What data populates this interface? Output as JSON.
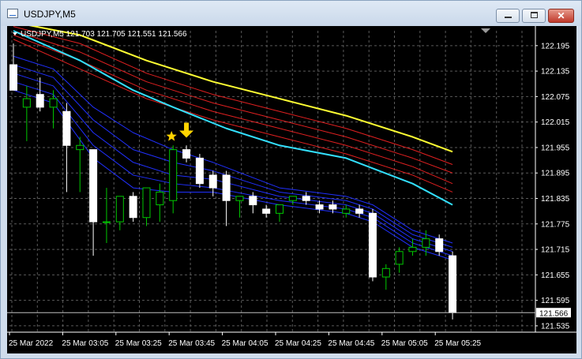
{
  "window": {
    "title": "USDJPY,M5",
    "close_glyph": "✕"
  },
  "chart_header": {
    "text": "USDJPY,M5  121.703 121.705 121.551 121.566"
  },
  "price_tag": "121.566",
  "colors": {
    "background": "#000000",
    "grid": "#5a5a5a",
    "bull": "#00c800",
    "bear": "#ffffff",
    "yellow": "#ffff33",
    "cyan": "#33e0ff",
    "red": "#e02020",
    "blue": "#2030ff",
    "marker": "#ffd400"
  },
  "icons": {
    "star": "star-icon",
    "arrow": "arrow-down-icon",
    "menu": "triangle-down-icon",
    "scroll": "triangle-down-icon"
  },
  "chart_data": {
    "type": "candlestick",
    "symbol": "USDJPY",
    "timeframe": "M5",
    "ylim": [
      121.52,
      122.23
    ],
    "price_ticks": [
      "122.195",
      "122.135",
      "122.075",
      "122.015",
      "121.955",
      "121.895",
      "121.835",
      "121.775",
      "121.715",
      "121.655",
      "121.595",
      "121.535"
    ],
    "time_labels": [
      {
        "index": 0,
        "label": "25 Mar 2022"
      },
      {
        "index": 4,
        "label": "25 Mar 03:05"
      },
      {
        "index": 8,
        "label": "25 Mar 03:25"
      },
      {
        "index": 12,
        "label": "25 Mar 03:45"
      },
      {
        "index": 16,
        "label": "25 Mar 04:05"
      },
      {
        "index": 20,
        "label": "25 Mar 04:25"
      },
      {
        "index": 24,
        "label": "25 Mar 04:45"
      },
      {
        "index": 28,
        "label": "25 Mar 05:05"
      },
      {
        "index": 32,
        "label": "25 Mar 05:25"
      }
    ],
    "candles": [
      {
        "o": 122.15,
        "h": 122.2,
        "l": 122.1,
        "c": 122.09
      },
      {
        "o": 122.05,
        "h": 122.1,
        "l": 121.97,
        "c": 122.07
      },
      {
        "o": 122.08,
        "h": 122.12,
        "l": 122.04,
        "c": 122.05
      },
      {
        "o": 122.05,
        "h": 122.09,
        "l": 122.0,
        "c": 122.07
      },
      {
        "o": 122.04,
        "h": 122.06,
        "l": 121.85,
        "c": 121.96
      },
      {
        "o": 121.95,
        "h": 121.98,
        "l": 121.85,
        "c": 121.96
      },
      {
        "o": 121.95,
        "h": 121.95,
        "l": 121.7,
        "c": 121.78
      },
      {
        "o": 121.78,
        "h": 121.86,
        "l": 121.73,
        "c": 121.78
      },
      {
        "o": 121.78,
        "h": 121.84,
        "l": 121.76,
        "c": 121.84
      },
      {
        "o": 121.84,
        "h": 121.85,
        "l": 121.78,
        "c": 121.79
      },
      {
        "o": 121.79,
        "h": 121.86,
        "l": 121.77,
        "c": 121.86
      },
      {
        "o": 121.82,
        "h": 121.87,
        "l": 121.78,
        "c": 121.85
      },
      {
        "o": 121.83,
        "h": 121.96,
        "l": 121.8,
        "c": 121.95
      },
      {
        "o": 121.95,
        "h": 121.96,
        "l": 121.92,
        "c": 121.93
      },
      {
        "o": 121.93,
        "h": 121.94,
        "l": 121.86,
        "c": 121.87
      },
      {
        "o": 121.89,
        "h": 121.9,
        "l": 121.84,
        "c": 121.86
      },
      {
        "o": 121.89,
        "h": 121.9,
        "l": 121.77,
        "c": 121.83
      },
      {
        "o": 121.83,
        "h": 121.84,
        "l": 121.79,
        "c": 121.84
      },
      {
        "o": 121.84,
        "h": 121.85,
        "l": 121.8,
        "c": 121.82
      },
      {
        "o": 121.81,
        "h": 121.82,
        "l": 121.79,
        "c": 121.8
      },
      {
        "o": 121.8,
        "h": 121.82,
        "l": 121.78,
        "c": 121.82
      },
      {
        "o": 121.83,
        "h": 121.84,
        "l": 121.82,
        "c": 121.84
      },
      {
        "o": 121.84,
        "h": 121.85,
        "l": 121.82,
        "c": 121.83
      },
      {
        "o": 121.82,
        "h": 121.83,
        "l": 121.8,
        "c": 121.81
      },
      {
        "o": 121.82,
        "h": 121.83,
        "l": 121.8,
        "c": 121.81
      },
      {
        "o": 121.8,
        "h": 121.82,
        "l": 121.79,
        "c": 121.81
      },
      {
        "o": 121.81,
        "h": 121.82,
        "l": 121.79,
        "c": 121.8
      },
      {
        "o": 121.8,
        "h": 121.81,
        "l": 121.64,
        "c": 121.65
      },
      {
        "o": 121.65,
        "h": 121.68,
        "l": 121.62,
        "c": 121.67
      },
      {
        "o": 121.68,
        "h": 121.72,
        "l": 121.66,
        "c": 121.71
      },
      {
        "o": 121.71,
        "h": 121.74,
        "l": 121.7,
        "c": 121.72
      },
      {
        "o": 121.72,
        "h": 121.76,
        "l": 121.7,
        "c": 121.74
      },
      {
        "o": 121.74,
        "h": 121.75,
        "l": 121.7,
        "c": 121.71
      },
      {
        "o": 121.7,
        "h": 121.71,
        "l": 121.55,
        "c": 121.566
      }
    ],
    "indicators": [
      {
        "name": "yellow-ma",
        "color": "#ffff33",
        "width": 2,
        "points": [
          [
            0,
            122.25
          ],
          [
            5,
            122.22
          ],
          [
            10,
            122.16
          ],
          [
            15,
            122.11
          ],
          [
            20,
            122.07
          ],
          [
            25,
            122.03
          ],
          [
            30,
            121.98
          ],
          [
            33,
            121.945
          ]
        ]
      },
      {
        "name": "red-ma-1",
        "color": "#e02020",
        "width": 1,
        "points": [
          [
            0,
            122.24
          ],
          [
            5,
            122.2
          ],
          [
            10,
            122.13
          ],
          [
            15,
            122.08
          ],
          [
            20,
            122.04
          ],
          [
            25,
            122.0
          ],
          [
            30,
            121.95
          ],
          [
            33,
            121.915
          ]
        ]
      },
      {
        "name": "red-ma-2",
        "color": "#e02020",
        "width": 1,
        "points": [
          [
            0,
            122.23
          ],
          [
            5,
            122.18
          ],
          [
            10,
            122.11
          ],
          [
            15,
            122.06
          ],
          [
            20,
            122.02
          ],
          [
            25,
            121.98
          ],
          [
            30,
            121.93
          ],
          [
            33,
            121.895
          ]
        ]
      },
      {
        "name": "red-ma-3",
        "color": "#e02020",
        "width": 1,
        "points": [
          [
            0,
            122.22
          ],
          [
            5,
            122.16
          ],
          [
            10,
            122.09
          ],
          [
            15,
            122.04
          ],
          [
            20,
            122.0
          ],
          [
            25,
            121.96
          ],
          [
            30,
            121.91
          ],
          [
            33,
            121.87
          ]
        ]
      },
      {
        "name": "red-ma-4",
        "color": "#e02020",
        "width": 1,
        "points": [
          [
            0,
            122.21
          ],
          [
            5,
            122.14
          ],
          [
            10,
            122.07
          ],
          [
            15,
            122.02
          ],
          [
            20,
            121.98
          ],
          [
            25,
            121.94
          ],
          [
            30,
            121.89
          ],
          [
            33,
            121.85
          ]
        ]
      },
      {
        "name": "cyan-ma",
        "color": "#33e0ff",
        "width": 2,
        "points": [
          [
            0,
            122.23
          ],
          [
            5,
            122.16
          ],
          [
            9,
            122.09
          ],
          [
            12,
            122.05
          ],
          [
            16,
            122.0
          ],
          [
            20,
            121.96
          ],
          [
            25,
            121.93
          ],
          [
            30,
            121.87
          ],
          [
            33,
            121.82
          ]
        ]
      },
      {
        "name": "blue-ma-1",
        "color": "#2030ff",
        "width": 1,
        "points": [
          [
            0,
            122.17
          ],
          [
            3,
            122.14
          ],
          [
            6,
            122.05
          ],
          [
            9,
            121.99
          ],
          [
            12,
            121.95
          ],
          [
            15,
            121.92
          ],
          [
            20,
            121.86
          ],
          [
            25,
            121.84
          ],
          [
            27,
            121.82
          ],
          [
            30,
            121.76
          ],
          [
            33,
            121.73
          ]
        ]
      },
      {
        "name": "blue-ma-2",
        "color": "#2030ff",
        "width": 1,
        "points": [
          [
            0,
            122.15
          ],
          [
            3,
            122.12
          ],
          [
            6,
            122.02
          ],
          [
            9,
            121.95
          ],
          [
            12,
            121.92
          ],
          [
            15,
            121.9
          ],
          [
            20,
            121.85
          ],
          [
            25,
            121.83
          ],
          [
            27,
            121.81
          ],
          [
            30,
            121.75
          ],
          [
            33,
            121.72
          ]
        ]
      },
      {
        "name": "blue-ma-3",
        "color": "#2030ff",
        "width": 1,
        "points": [
          [
            0,
            122.13
          ],
          [
            3,
            122.1
          ],
          [
            6,
            121.99
          ],
          [
            9,
            121.92
          ],
          [
            12,
            121.89
          ],
          [
            15,
            121.88
          ],
          [
            20,
            121.84
          ],
          [
            25,
            121.82
          ],
          [
            27,
            121.8
          ],
          [
            30,
            121.74
          ],
          [
            33,
            121.71
          ]
        ]
      },
      {
        "name": "blue-ma-4",
        "color": "#2030ff",
        "width": 1,
        "points": [
          [
            0,
            122.11
          ],
          [
            3,
            122.08
          ],
          [
            6,
            121.96
          ],
          [
            9,
            121.89
          ],
          [
            12,
            121.87
          ],
          [
            15,
            121.86
          ],
          [
            20,
            121.83
          ],
          [
            25,
            121.81
          ],
          [
            27,
            121.79
          ],
          [
            30,
            121.73
          ],
          [
            33,
            121.7
          ]
        ]
      },
      {
        "name": "blue-ma-5",
        "color": "#2030ff",
        "width": 1,
        "points": [
          [
            0,
            122.09
          ],
          [
            3,
            122.06
          ],
          [
            6,
            121.93
          ],
          [
            9,
            121.86
          ],
          [
            12,
            121.85
          ],
          [
            15,
            121.85
          ],
          [
            20,
            121.82
          ],
          [
            25,
            121.8
          ],
          [
            27,
            121.78
          ],
          [
            30,
            121.72
          ],
          [
            33,
            121.69
          ]
        ]
      }
    ],
    "markers": [
      {
        "type": "star",
        "index": 12,
        "price": 121.97,
        "color": "#ffd400"
      },
      {
        "type": "arrow-down",
        "index": 13,
        "price": 121.98,
        "color": "#ffd400"
      }
    ],
    "bid_line": 121.566
  }
}
